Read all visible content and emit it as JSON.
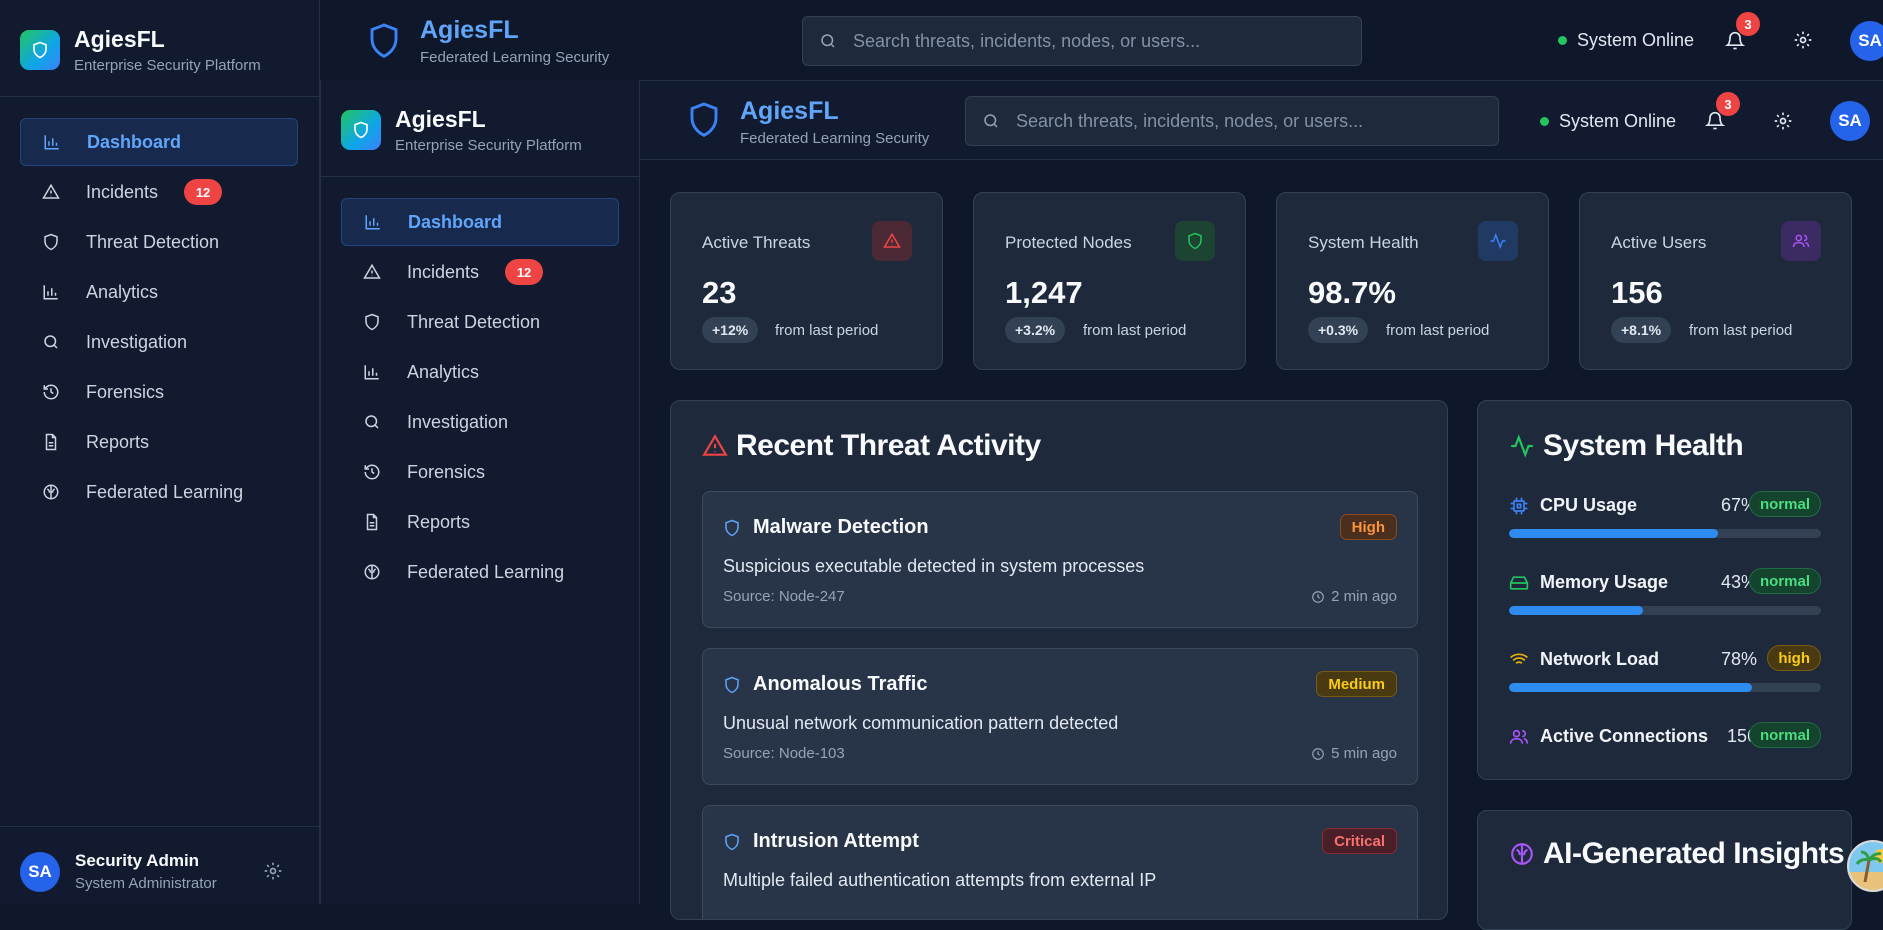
{
  "brand": {
    "name": "AgiesFL",
    "subtitle": "Enterprise Security Platform",
    "header_subtitle": "Federated Learning Security"
  },
  "nav": {
    "items": [
      {
        "label": "Dashboard",
        "icon": "bar-chart-icon",
        "active": true
      },
      {
        "label": "Incidents",
        "icon": "alert-triangle-icon",
        "badge": "12"
      },
      {
        "label": "Threat Detection",
        "icon": "shield-icon"
      },
      {
        "label": "Analytics",
        "icon": "bar-chart-icon"
      },
      {
        "label": "Investigation",
        "icon": "search-icon"
      },
      {
        "label": "Forensics",
        "icon": "history-icon"
      },
      {
        "label": "Reports",
        "icon": "file-text-icon"
      },
      {
        "label": "Federated Learning",
        "icon": "brain-icon"
      }
    ]
  },
  "user": {
    "initials": "SA",
    "name": "Security Admin",
    "role": "System Administrator"
  },
  "header": {
    "search_placeholder": "Search threats, incidents, nodes, or users...",
    "status": "System Online",
    "notifications": "3"
  },
  "stats": [
    {
      "title": "Active Threats",
      "value": "23",
      "change": "+12%",
      "note": "from last period",
      "icon": "alert-triangle-icon",
      "color": "#ef4444"
    },
    {
      "title": "Protected Nodes",
      "value": "1,247",
      "change": "+3.2%",
      "note": "from last period",
      "icon": "shield-icon",
      "color": "#22c55e"
    },
    {
      "title": "System Health",
      "value": "98.7%",
      "change": "+0.3%",
      "note": "from last period",
      "icon": "activity-icon",
      "color": "#3b82f6"
    },
    {
      "title": "Active Users",
      "value": "156",
      "change": "+8.1%",
      "note": "from last period",
      "icon": "users-icon",
      "color": "#a855f7"
    }
  ],
  "threats": {
    "title": "Recent Threat Activity",
    "items": [
      {
        "name": "Malware Detection",
        "severity": "High",
        "description": "Suspicious executable detected in system processes",
        "source": "Source: Node-247",
        "time": "2 min ago"
      },
      {
        "name": "Anomalous Traffic",
        "severity": "Medium",
        "description": "Unusual network communication pattern detected",
        "source": "Source: Node-103",
        "time": "5 min ago"
      },
      {
        "name": "Intrusion Attempt",
        "severity": "Critical",
        "description": "Multiple failed authentication attempts from external IP",
        "source": "",
        "time": ""
      }
    ]
  },
  "health": {
    "title": "System Health",
    "rows": [
      {
        "label": "CPU Usage",
        "value": "67%",
        "level": 0.67,
        "status": "normal",
        "icon": "cpu-icon"
      },
      {
        "label": "Memory Usage",
        "value": "43%",
        "level": 0.43,
        "status": "normal",
        "icon": "hard-drive-icon"
      },
      {
        "label": "Network Load",
        "value": "78%",
        "level": 0.78,
        "status": "high",
        "icon": "wifi-icon"
      },
      {
        "label": "Active Connections",
        "value": "156",
        "status": "normal",
        "icon": "users-icon"
      }
    ]
  },
  "insights": {
    "title": "AI-Generated Insights"
  }
}
